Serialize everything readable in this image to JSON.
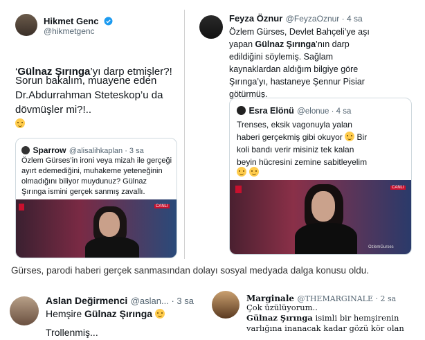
{
  "left_tweet": {
    "name": "Hikmet Genc",
    "handle": "@hikmetgenc",
    "text_line1_pre": "‘",
    "text_line1_bold": "Gülnaz Şırınga",
    "text_line1_post": "’yı darp etmişler?!",
    "text_rest": "Sorun bakalım, muayene eden\nDr.Abdurrahman Steteskop’u da\ndövmüşler mi?!..",
    "quote": {
      "name": "Sparrow",
      "handle": "@alisalihkaplan · 3 sa",
      "text": "Özlem Gürses’in ironi veya mizah ile gerçeği ayırt edemediğini, muhakeme yeteneğinin olmadığını biliyor muydunuz? Gülnaz Şırınga ismini gerçek sanmış zavallı."
    }
  },
  "right_tweet": {
    "name": "Feyza Öznur",
    "handle": "@FeyzaOznur · 4 sa",
    "text_a": "Özlem Gürses, Devlet Bahçeli’ye aşı\nyapan ",
    "text_bold": "Gülnaz Şırınga",
    "text_b": "’nın darp\nedildiğini söylemiş. Sağlam\nkaynaklardan aldığım bilgiye göre\nŞırınga’yı, hastaneye Şennur Pisiar\ngötürmüş.",
    "quote": {
      "name": "Esra Elönü",
      "handle": "@elonue · 4 sa",
      "text": "Trenses, eksik vagonuyla yalan\nhaberi gerçekmiş gibi okuyor",
      "text2": "Bir\nkoli bandı verir misiniz tek kalan\nbeyin hücresini zemine sabitleyelim",
      "live_badge": "CANLI",
      "watermark": "OzlemGurses"
    }
  },
  "left_video_badge": "CANLI",
  "caption": "Gürses, parodi haberi gerçek sanmasından dolayı sosyal medyada dalga konusu oldu.",
  "bottom_left": {
    "name": "Aslan Değirmenci",
    "handle": "@aslan... · 3 sa",
    "text_pre": "Hemşire ",
    "text_bold": "Gülnaz Şırınga",
    "text2": "Trollenmiş..."
  },
  "bottom_right": {
    "name": "Marginale",
    "handle": "@THEMARGINALE · 2 sa",
    "text1": "Çok üzülüyorum..",
    "text_bold": "Gülnaz Şırınga",
    "text2": " isimli bir hemşirenin",
    "text3": "varlığına inanacak kadar gözü kör olan"
  },
  "colors": {
    "verified": "#1d9bf0",
    "halk_tv": "#c8102e",
    "text": "#0f1419",
    "muted": "#536471"
  }
}
